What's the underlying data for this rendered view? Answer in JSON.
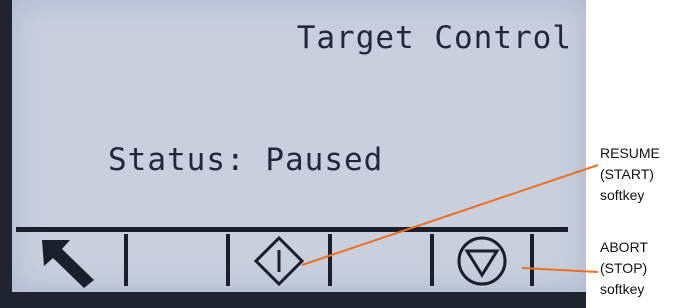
{
  "screen": {
    "title": "Target Control",
    "status_label": "Status:",
    "status_value": "Paused"
  },
  "softkeys": [
    {
      "icon": "up-left-arrow-icon"
    },
    {
      "icon": "blank"
    },
    {
      "icon": "diamond-start-icon"
    },
    {
      "icon": "blank"
    },
    {
      "icon": "circle-stop-icon"
    }
  ],
  "callouts": {
    "resume": {
      "line1": "RESUME",
      "line2": "(START)",
      "line3": "softkey"
    },
    "abort": {
      "line1": "ABORT",
      "line2": "(STOP)",
      "line3": "softkey"
    }
  },
  "colors": {
    "lcd_background": "#c8d0de",
    "lcd_text": "#22283a",
    "bezel": "#1f2430",
    "callout_line": "#f07020"
  }
}
